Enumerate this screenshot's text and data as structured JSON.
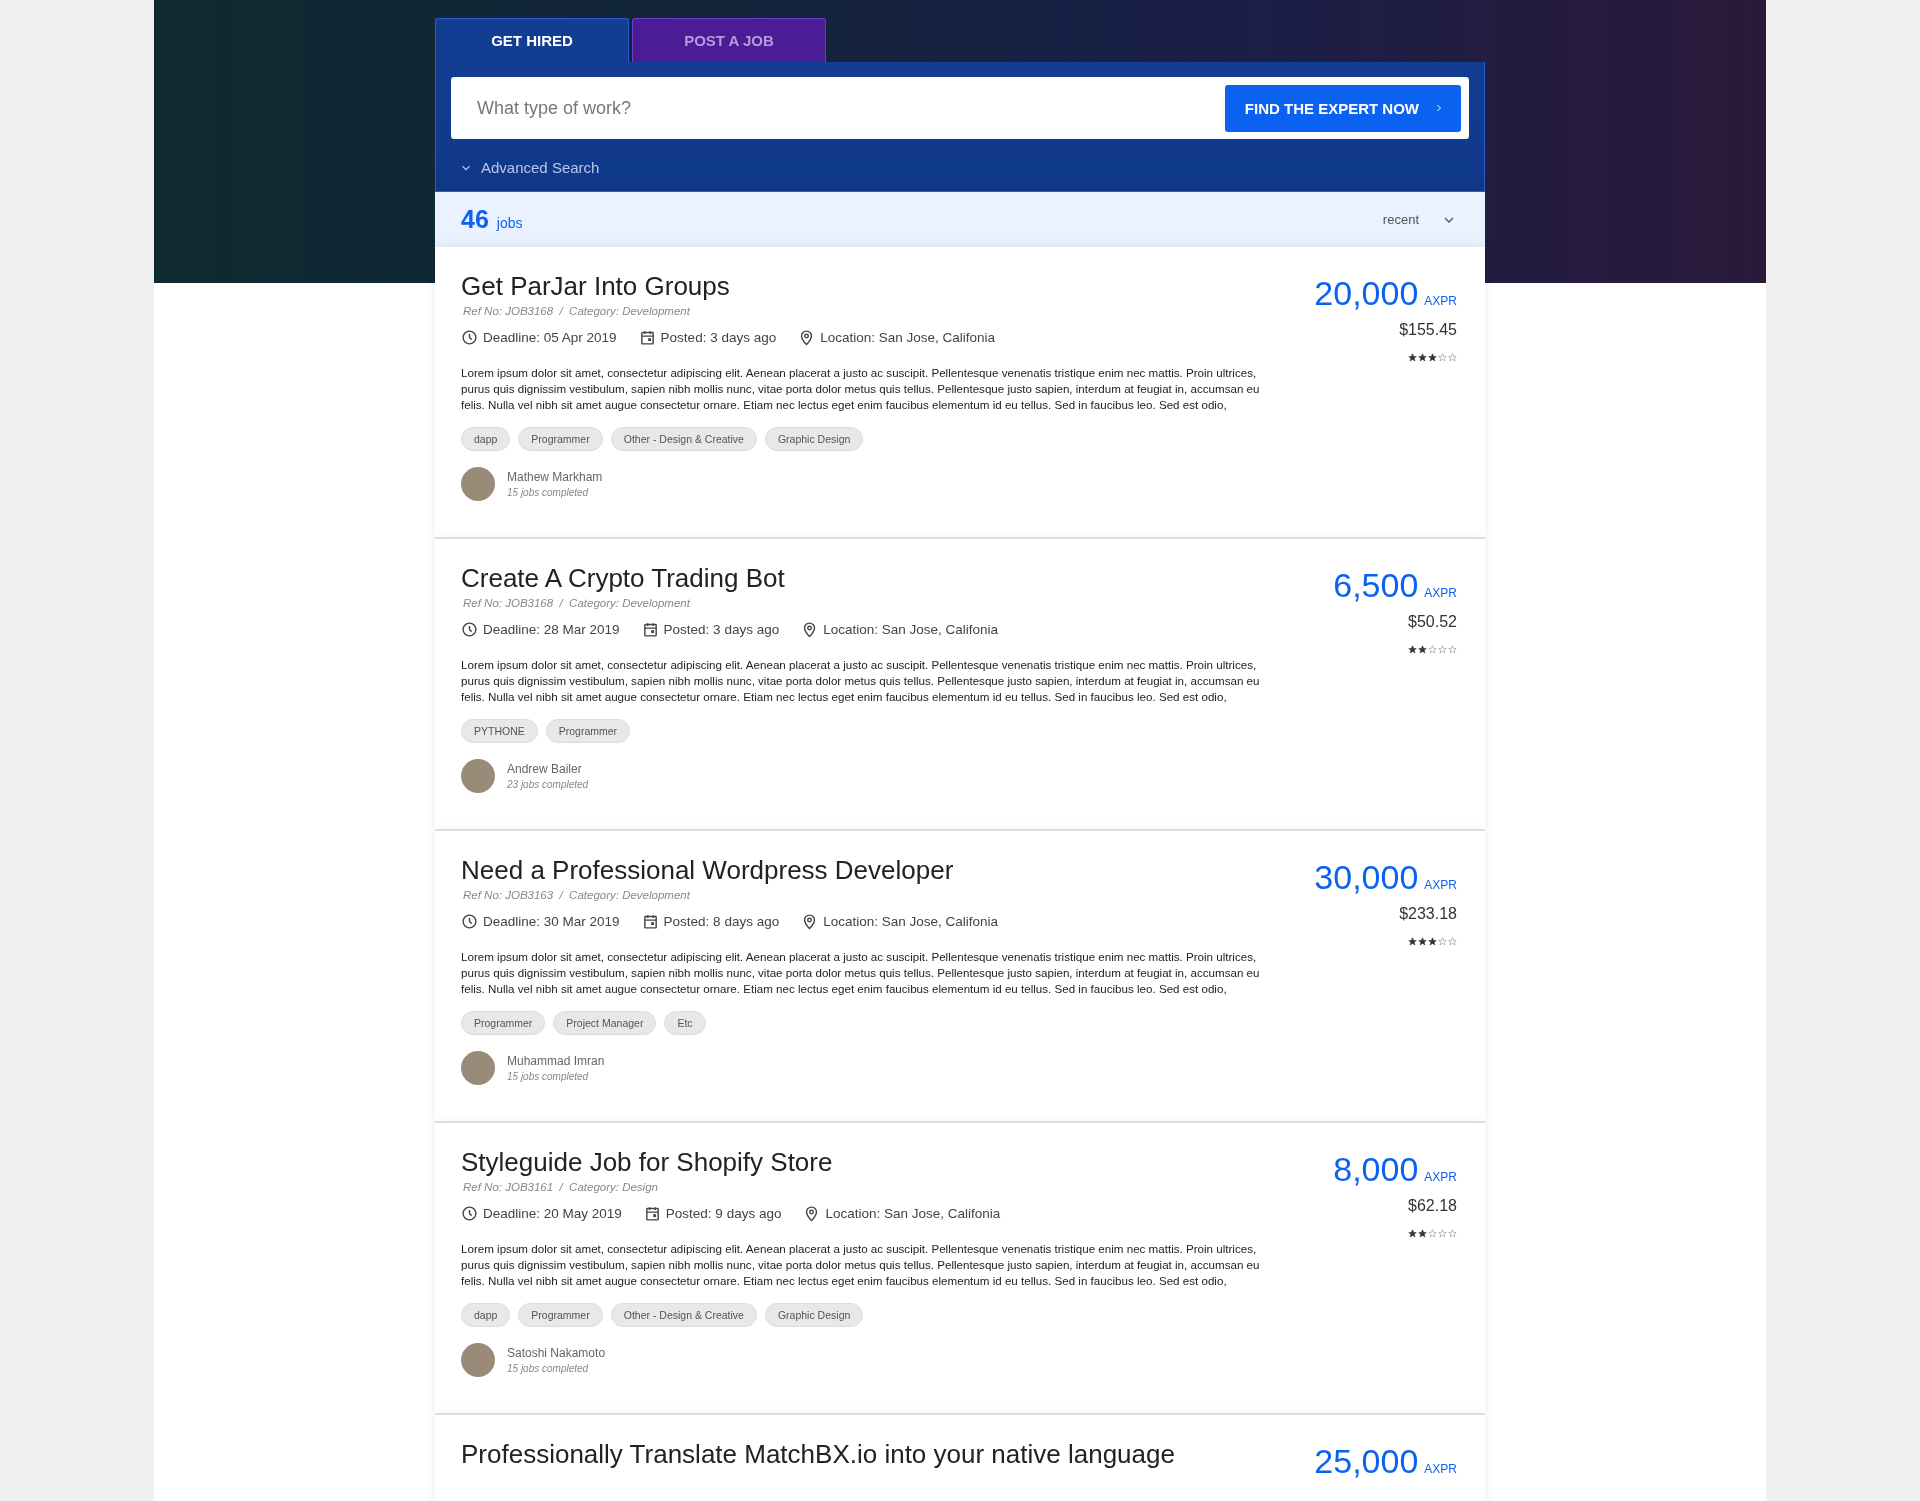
{
  "tabs": [
    {
      "label": "GET HIRED",
      "selected": true
    },
    {
      "label": "POST A JOB",
      "selected": false
    }
  ],
  "search": {
    "placeholder": "What type of work?",
    "button": "FIND THE EXPERT NOW"
  },
  "advanced_search": "Advanced Search",
  "results": {
    "count": "46",
    "unit": "jobs",
    "sort": "recent"
  },
  "jobs": [
    {
      "title": "Get ParJar Into Groups",
      "ref": "Ref No: JOB3168  /  Category: Development",
      "deadline": "Deadline: 05 Apr 2019",
      "posted": "Posted: 3 days ago",
      "location": "Location: San Jose, Califonia",
      "description": "Lorem ipsum dolor sit amet, consectetur adipiscing elit. Aenean placerat a justo ac suscipit. Pellentesque venenatis tristique enim nec mattis. Proin ultrices, purus quis dignissim vestibulum, sapien nibh mollis nunc, vitae porta dolor metus quis tellus. Pellentesque justo sapien, interdum at feugiat in, accumsan eu felis. Nulla vel nibh sit amet augue consectetur ornare. Etiam nec lectus eget enim faucibus elementum id eu tellus. Sed in faucibus leo. Sed est odio,",
      "tags": [
        "dapp",
        "Programmer",
        "Other - Design & Creative",
        "Graphic Design"
      ],
      "price": "20,000",
      "currency": "AXPR",
      "usd": "$155.45",
      "stars": 3,
      "client": {
        "name": "Mathew Markham",
        "completed": "15 jobs completed"
      }
    },
    {
      "title": "Create A Crypto Trading Bot",
      "ref": "Ref No: JOB3168  /  Category: Development",
      "deadline": "Deadline: 28 Mar 2019",
      "posted": "Posted: 3 days ago",
      "location": "Location: San Jose, Califonia",
      "description": "Lorem ipsum dolor sit amet, consectetur adipiscing elit. Aenean placerat a justo ac suscipit. Pellentesque venenatis tristique enim nec mattis. Proin ultrices, purus quis dignissim vestibulum, sapien nibh mollis nunc, vitae porta dolor metus quis tellus. Pellentesque justo sapien, interdum at feugiat in, accumsan eu felis. Nulla vel nibh sit amet augue consectetur ornare. Etiam nec lectus eget enim faucibus elementum id eu tellus. Sed in faucibus leo. Sed est odio,",
      "tags": [
        "PYTHONE",
        "Programmer"
      ],
      "price": "6,500",
      "currency": "AXPR",
      "usd": "$50.52",
      "stars": 2,
      "client": {
        "name": "Andrew Bailer",
        "completed": "23 jobs completed"
      }
    },
    {
      "title": "Need a Professional Wordpress Developer",
      "ref": "Ref No: JOB3163  /  Category: Development",
      "deadline": "Deadline: 30 Mar 2019",
      "posted": "Posted: 8 days ago",
      "location": "Location: San Jose, Califonia",
      "description": "Lorem ipsum dolor sit amet, consectetur adipiscing elit. Aenean placerat a justo ac suscipit. Pellentesque venenatis tristique enim nec mattis. Proin ultrices, purus quis dignissim vestibulum, sapien nibh mollis nunc, vitae porta dolor metus quis tellus. Pellentesque justo sapien, interdum at feugiat in, accumsan eu felis. Nulla vel nibh sit amet augue consectetur ornare. Etiam nec lectus eget enim faucibus elementum id eu tellus. Sed in faucibus leo. Sed est odio,",
      "tags": [
        "Programmer",
        "Project Manager",
        "Etc"
      ],
      "price": "30,000",
      "currency": "AXPR",
      "usd": "$233.18",
      "stars": 3,
      "client": {
        "name": "Muhammad Imran",
        "completed": "15 jobs completed"
      }
    },
    {
      "title": "Styleguide Job for Shopify Store",
      "ref": "Ref No: JOB3161  /  Category: Design",
      "deadline": "Deadline: 20 May 2019",
      "posted": "Posted: 9 days ago",
      "location": "Location: San Jose, Califonia",
      "description": "Lorem ipsum dolor sit amet, consectetur adipiscing elit. Aenean placerat a justo ac suscipit. Pellentesque venenatis tristique enim nec mattis. Proin ultrices, purus quis dignissim vestibulum, sapien nibh mollis nunc, vitae porta dolor metus quis tellus. Pellentesque justo sapien, interdum at feugiat in, accumsan eu felis. Nulla vel nibh sit amet augue consectetur ornare. Etiam nec lectus eget enim faucibus elementum id eu tellus. Sed in faucibus leo. Sed est odio,",
      "tags": [
        "dapp",
        "Programmer",
        "Other - Design & Creative",
        "Graphic Design"
      ],
      "price": "8,000",
      "currency": "AXPR",
      "usd": "$62.18",
      "stars": 2,
      "client": {
        "name": "Satoshi Nakamoto",
        "completed": "15 jobs completed"
      }
    },
    {
      "title": "Professionally Translate MatchBX.io into your native language",
      "price": "25,000",
      "currency": "AXPR"
    }
  ]
}
